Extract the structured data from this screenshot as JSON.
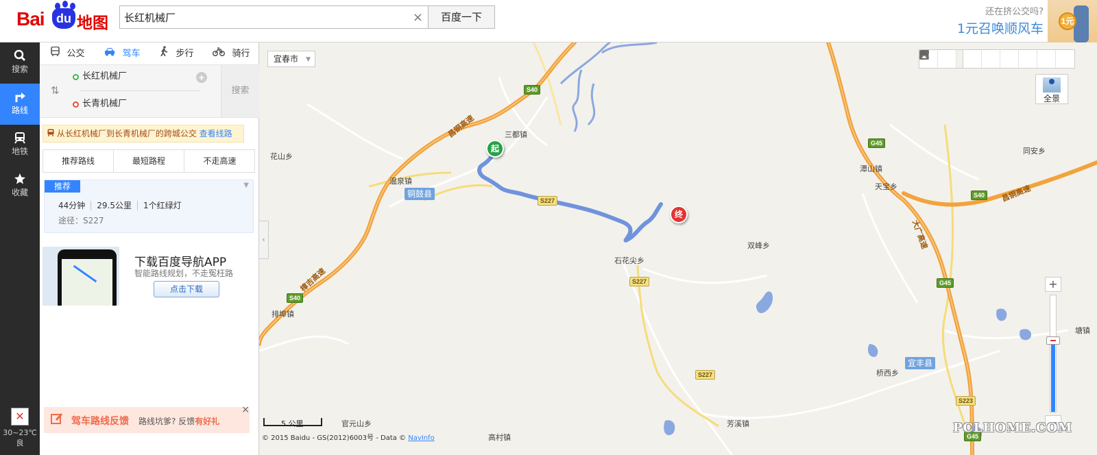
{
  "header": {
    "logo_bai": "Bai",
    "logo_du": "du",
    "logo_ditu": "地图",
    "search_value": "长红机械厂",
    "clear": "×",
    "search_button": "百度一下",
    "promo_line1": "还在挤公交吗?",
    "promo_line2": "1元召唤顺风车",
    "promo_coin": "1元"
  },
  "nav": {
    "items": [
      {
        "label": "搜索",
        "icon": "magnifier-icon"
      },
      {
        "label": "路线",
        "icon": "turn-arrow-icon"
      },
      {
        "label": "地铁",
        "icon": "subway-icon"
      },
      {
        "label": "收藏",
        "icon": "star-icon"
      }
    ],
    "weather_temp": "30~23℃",
    "weather_air": "良"
  },
  "panel": {
    "modes": [
      {
        "label": "公交",
        "icon": "bus-icon"
      },
      {
        "label": "驾车",
        "icon": "car-icon"
      },
      {
        "label": "步行",
        "icon": "walk-icon"
      },
      {
        "label": "骑行",
        "icon": "bike-icon"
      }
    ],
    "start": "长红机械厂",
    "end": "长青机械厂",
    "search_button": "搜索",
    "bus_tip": "从长红机械厂到长青机械厂的跨城公交",
    "bus_tip_link": "查看线路",
    "tabs": [
      "推荐路线",
      "最短路程",
      "不走高速"
    ],
    "route": {
      "badge": "推荐",
      "time": "44分钟",
      "distance": "29.5公里",
      "lights": "1个红绿灯",
      "via": "途径：S227"
    },
    "app": {
      "title": "下载百度导航APP",
      "subtitle": "智能路线规划，不走冤枉路",
      "button": "点击下载"
    },
    "feedback": {
      "title": "驾车路线反馈",
      "sub_prefix": "路线坑爹? 反馈",
      "sub_highlight": "有好礼",
      "close": "×"
    }
  },
  "map": {
    "city": "宜春市",
    "panorama": "全景",
    "scale": "5 公里",
    "copyright": "© 2015 Baidu - GS(2012)6003号 - Data ©",
    "copyright_link": "NavInfo",
    "watermark": "PCLHOME.COM",
    "start_marker": "起",
    "end_marker": "终",
    "zoom_level_fraction": 0.62,
    "towns": [
      "三都镇",
      "花山乡",
      "温泉镇",
      "石花尖乡",
      "双峰乡",
      "排埠镇",
      "官元山乡",
      "高村镇",
      "芳溪镇",
      "潭山镇",
      "天宝乡",
      "同安乡",
      "桥西乡",
      "塘镇"
    ],
    "counties": [
      "铜鼓县",
      "宜丰县"
    ],
    "shields": [
      "S40",
      "S40",
      "S40",
      "S227",
      "S227",
      "S227",
      "G45",
      "G45",
      "S223",
      "G45"
    ],
    "highway_names": [
      "昌铜高速",
      "昌铜高速",
      "樟吉高速",
      "大广高速"
    ],
    "tools": [
      "ranging-icon",
      "traffic-icon",
      "share-icon",
      "measure-icon",
      "mark-icon",
      "pin-icon",
      "print-icon",
      "fullscreen-icon"
    ],
    "colors": {
      "route": "#6f93dc",
      "highway": "#f2a33c",
      "water": "#8aa8e0",
      "start": "#27a247",
      "end": "#e23434",
      "accent": "#3385ff"
    }
  }
}
